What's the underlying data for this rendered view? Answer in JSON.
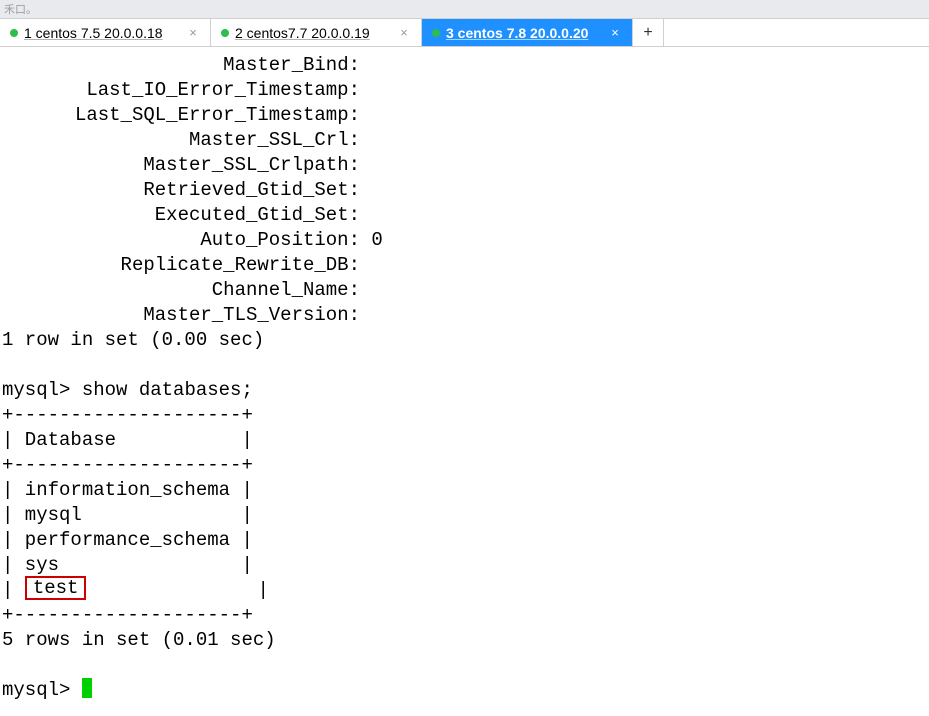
{
  "top_strip": "禾口。",
  "tabs": [
    {
      "label": "1 centos 7.5 20.0.0.18",
      "active": false
    },
    {
      "label": "2 centos7.7  20.0.0.19",
      "active": false
    },
    {
      "label": "3 centos 7.8 20.0.0.20",
      "active": true
    }
  ],
  "add_tab_label": "+",
  "status_fields": [
    {
      "key": "Master_Bind:",
      "val": ""
    },
    {
      "key": "Last_IO_Error_Timestamp:",
      "val": ""
    },
    {
      "key": "Last_SQL_Error_Timestamp:",
      "val": ""
    },
    {
      "key": "Master_SSL_Crl:",
      "val": ""
    },
    {
      "key": "Master_SSL_Crlpath:",
      "val": ""
    },
    {
      "key": "Retrieved_Gtid_Set:",
      "val": ""
    },
    {
      "key": "Executed_Gtid_Set:",
      "val": ""
    },
    {
      "key": "Auto_Position:",
      "val": " 0"
    },
    {
      "key": "Replicate_Rewrite_DB:",
      "val": ""
    },
    {
      "key": "Channel_Name:",
      "val": ""
    },
    {
      "key": "Master_TLS_Version:",
      "val": ""
    }
  ],
  "row_summary_1": "1 row in set (0.00 sec)",
  "prompt": "mysql>",
  "cmd_show_db": " show databases;",
  "hr": "+--------------------+",
  "db_header": "| Database           |",
  "db_rows_plain": [
    "| information_schema |",
    "| mysql              |",
    "| performance_schema |",
    "| sys                |"
  ],
  "db_row_highlight_pre": "| ",
  "db_row_highlight_text": "test",
  "db_row_highlight_post": "               |",
  "row_summary_2": "5 rows in set (0.01 sec)",
  "prompt_final": "mysql> "
}
